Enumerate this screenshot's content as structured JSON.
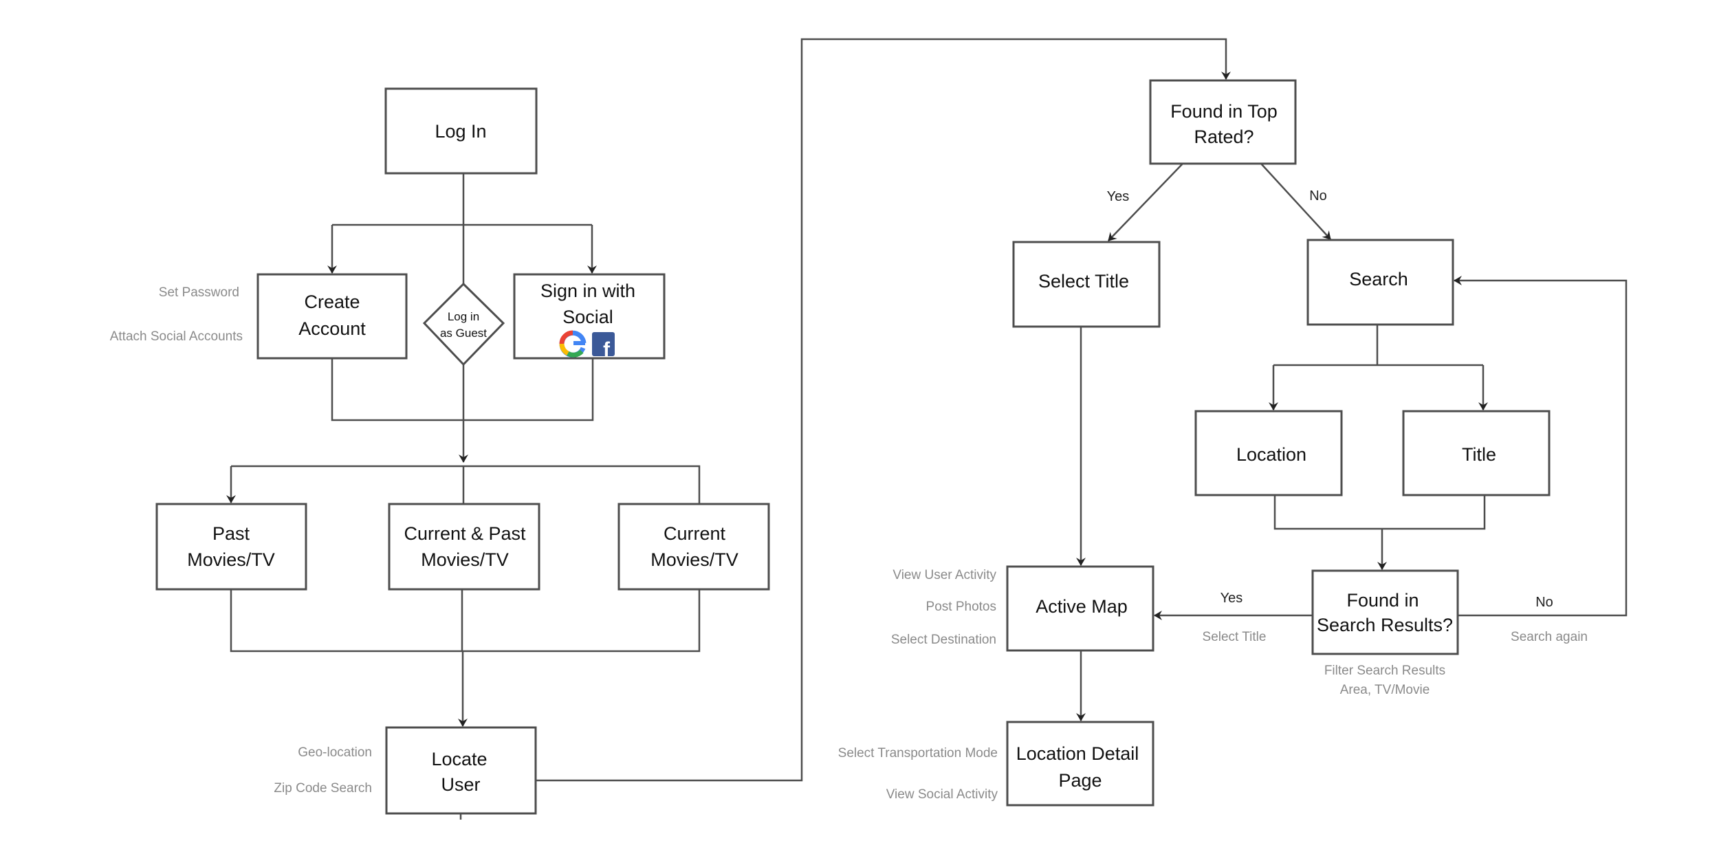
{
  "nodes": {
    "log_in": "Log In",
    "create_account": [
      "Create",
      "Account"
    ],
    "guest": [
      "Log in",
      "as Guest"
    ],
    "social": [
      "Sign in with",
      "Social"
    ],
    "past": [
      "Past",
      "Movies/TV"
    ],
    "current_past": [
      "Current & Past",
      "Movies/TV"
    ],
    "current": [
      "Current",
      "Movies/TV"
    ],
    "locate_user": [
      "Locate",
      "User"
    ],
    "top_rated": [
      "Found in Top",
      "Rated?"
    ],
    "select_title": "Select Title",
    "search": "Search",
    "location": "Location",
    "title": "Title",
    "search_results": [
      "Found in",
      "Search Results?"
    ],
    "active_map": "Active Map",
    "location_detail": [
      "Location Detail",
      "Page"
    ]
  },
  "annotations": {
    "set_password": "Set Password",
    "attach_social": "Attach Social Accounts",
    "geo_location": "Geo-location",
    "zip_code": "Zip Code Search",
    "view_user_activity": "View User Activity",
    "post_photos": "Post Photos",
    "select_destination": "Select Destination",
    "select_transport": "Select Transportation Mode",
    "view_social": "View Social Activity",
    "select_title_edge": "Select Title",
    "search_again": "Search again",
    "filter": [
      "Filter Search Results",
      "Area, TV/Movie"
    ]
  },
  "edges": {
    "yes_top": "Yes",
    "no_top": "No",
    "yes_results": "Yes",
    "no_results": "No"
  },
  "icons": [
    "google-icon",
    "facebook-icon"
  ],
  "colors": {
    "line": "#4d4d4d",
    "annotation": "#8a8a8a",
    "facebook": "#3b5998"
  }
}
